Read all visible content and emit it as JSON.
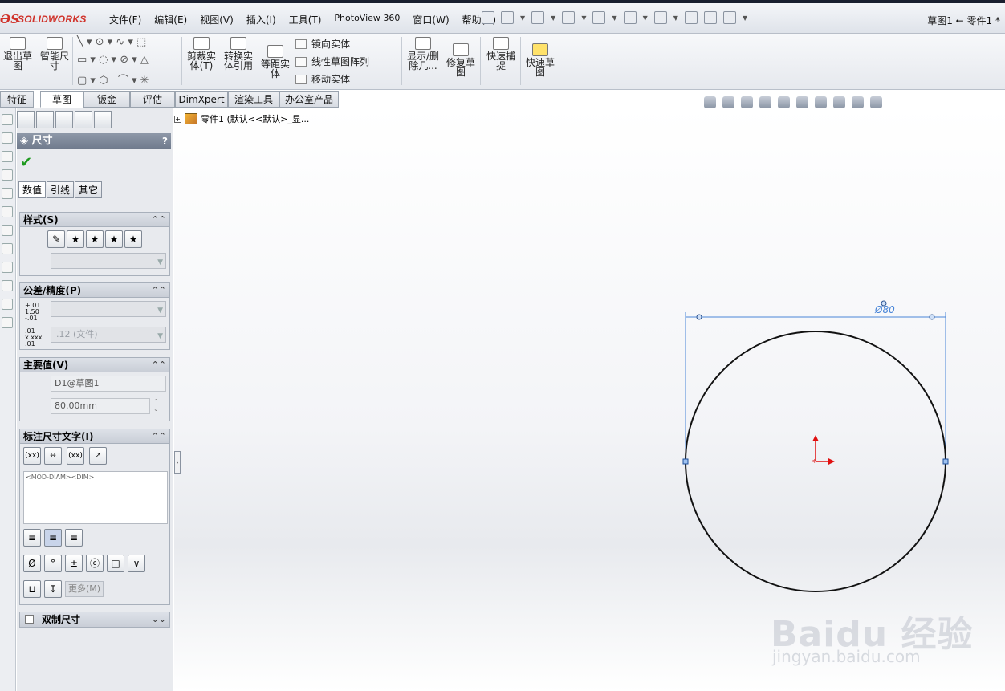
{
  "app": {
    "logo": "SOLIDWORKS",
    "title": "草图1 ← 零件1 *"
  },
  "menu": [
    "文件(F)",
    "编辑(E)",
    "视图(V)",
    "插入(I)",
    "工具(T)",
    "PhotoView 360",
    "窗口(W)",
    "帮助(H)"
  ],
  "ribbon": {
    "exit_sketch": "退出草图",
    "smart_dim": "智能尺寸",
    "trim": "剪裁实体(T)",
    "convert": "转换实体引用",
    "offset": "等距实体",
    "mirror": "镜向实体",
    "linear_pattern": "线性草图阵列",
    "move": "移动实体",
    "show_delete": "显示/删除几...",
    "repair": "修复草图",
    "quick_snap": "快速捕捉",
    "quick_sketch": "快速草图"
  },
  "tabs": [
    "特征",
    "草图",
    "钣金",
    "评估",
    "DimXpert",
    "渲染工具",
    "办公室产品"
  ],
  "pm": {
    "title": "尺寸",
    "help": "?",
    "subtabs": [
      "数值",
      "引线",
      "其它"
    ],
    "style_header": "样式(S)",
    "tol_header": "公差/精度(P)",
    "tol_icon_top": "+.01\n1.50\n-.01",
    "tol_icon_bottom": ".01\nx.xxx\n.01",
    "precision_value": ".12 (文件)",
    "primary_header": "主要值(V)",
    "primary_name": "D1@草图1",
    "primary_value": "80.00mm",
    "dimtext_header": "标注尺寸文字(I)",
    "dimtext_content": "<MOD-DIAM><DIM>",
    "symbols": [
      "Ø",
      "°",
      "±",
      "ⓒ",
      "□",
      "∨"
    ],
    "more": "更多(M)",
    "dual_header": "双制尺寸"
  },
  "tree": {
    "item": "零件1  (默认<<默认>_显..."
  },
  "drawing": {
    "dimension_label": "Ø80"
  },
  "watermark": {
    "line1": "Baidu 经验",
    "line2": "jingyan.baidu.com"
  },
  "colors": {
    "circle": "#000000",
    "dimension": "#3a7bd5",
    "origin": "#e01010"
  }
}
